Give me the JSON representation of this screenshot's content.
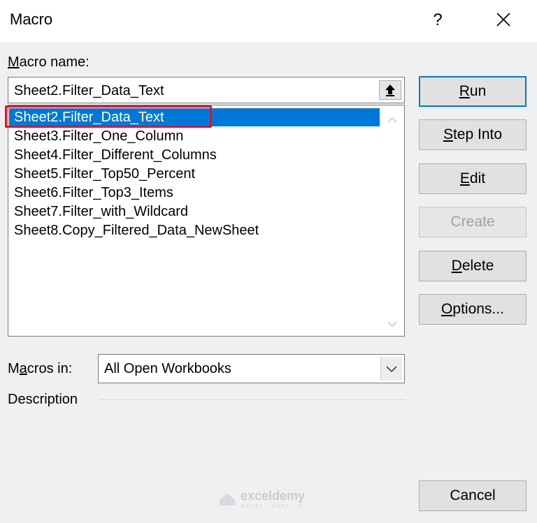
{
  "window": {
    "title": "Macro",
    "help_label": "?"
  },
  "macro_name": {
    "label_underlined": "M",
    "label_rest": "acro name:",
    "value": "Sheet2.Filter_Data_Text"
  },
  "macro_list": {
    "items": [
      "Sheet2.Filter_Data_Text",
      "Sheet3.Filter_One_Column",
      "Sheet4.Filter_Different_Columns",
      "Sheet5.Filter_Top50_Percent",
      "Sheet6.Filter_Top3_Items",
      "Sheet7.Filter_with_Wildcard",
      "Sheet8.Copy_Filtered_Data_NewSheet"
    ],
    "selected_index": 0
  },
  "buttons": {
    "run": {
      "underlined": "R",
      "rest": "un"
    },
    "step_into": {
      "underlined": "S",
      "rest": "tep Into"
    },
    "edit": {
      "underlined": "E",
      "rest": "dit"
    },
    "create": {
      "label": "Create"
    },
    "delete": {
      "underlined": "D",
      "rest": "elete"
    },
    "options": {
      "underlined": "O",
      "rest": "ptions..."
    },
    "cancel": {
      "label": "Cancel"
    }
  },
  "macros_in": {
    "label_pre": "M",
    "label_underlined": "a",
    "label_rest": "cros in:",
    "value": "All Open Workbooks"
  },
  "description": {
    "label": "Description"
  },
  "watermark": {
    "brand": "exceldemy",
    "tagline": "EXCEL · DATA · BI"
  },
  "colors": {
    "selection": "#0078d7",
    "highlight_box": "#e81123"
  }
}
